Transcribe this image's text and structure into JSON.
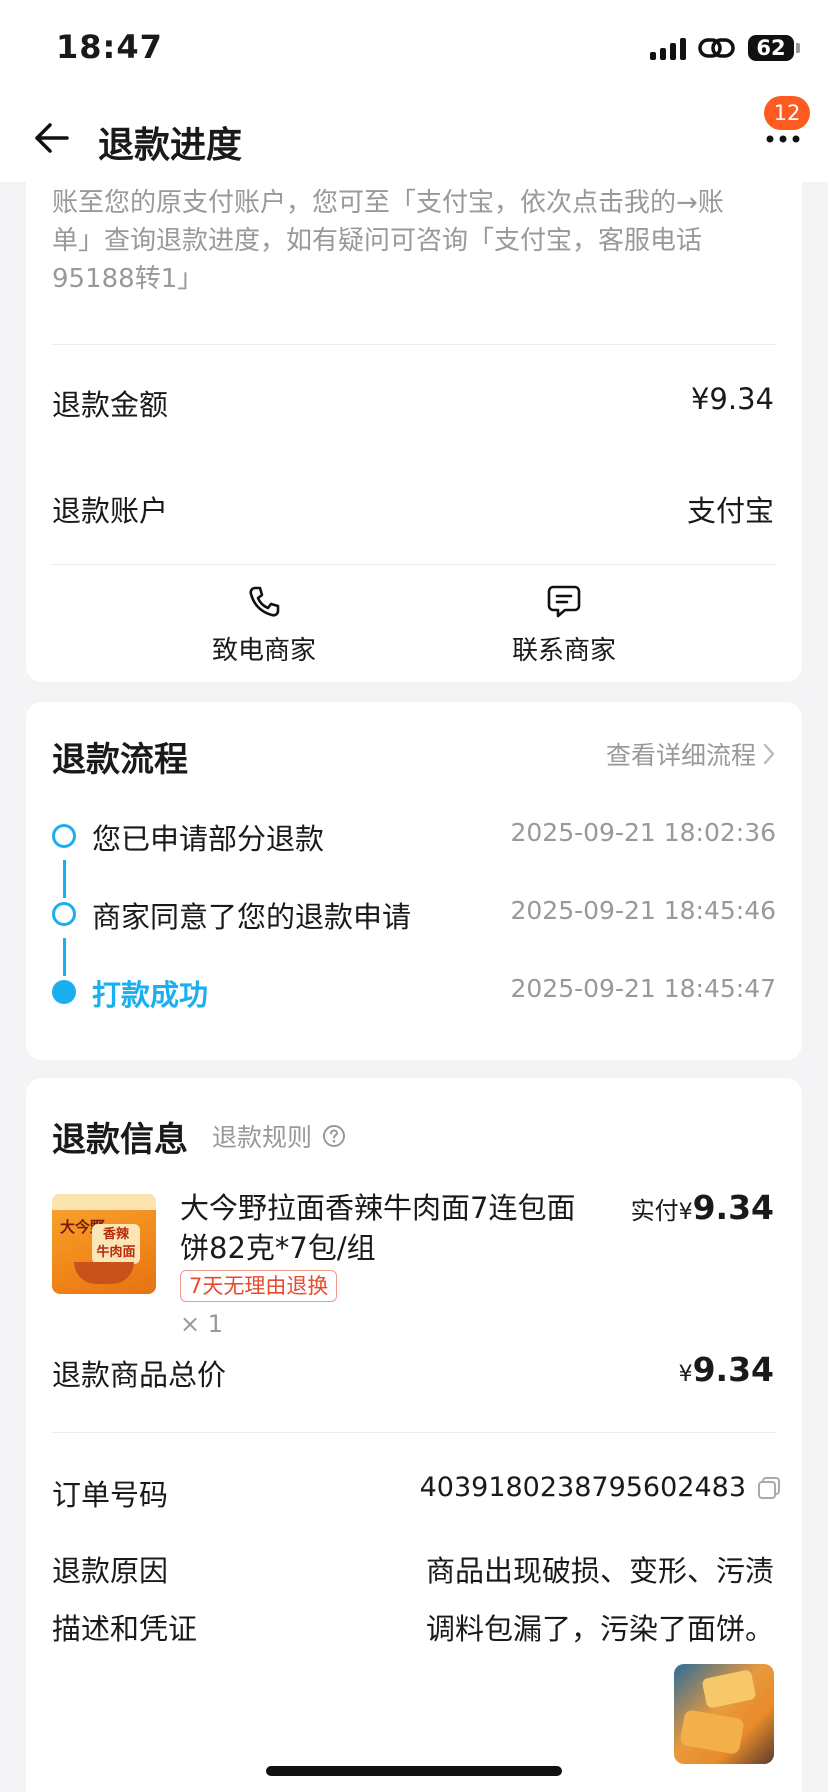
{
  "status_bar": {
    "time": "18:47",
    "battery": "62"
  },
  "header": {
    "title": "退款进度",
    "badge_count": "12"
  },
  "notice": {
    "text": "账至您的原支付账户，您可至「支付宝，依次点击我的→账单」查询退款进度，如有疑问可咨询「支付宝，客服电话95188转1」"
  },
  "refund_summary": {
    "amount_label": "退款金额",
    "amount_value": "¥9.34",
    "account_label": "退款账户",
    "account_value": "支付宝",
    "call_label": "致电商家",
    "contact_label": "联系商家"
  },
  "process": {
    "title": "退款流程",
    "detail_link": "查看详细流程",
    "steps": [
      {
        "label": "您已申请部分退款",
        "time": "2025-09-21 18:02:36"
      },
      {
        "label": "商家同意了您的退款申请",
        "time": "2025-09-21 18:45:46"
      },
      {
        "label": "打款成功",
        "time": "2025-09-21 18:45:47"
      }
    ]
  },
  "refund_info": {
    "title": "退款信息",
    "rules_link": "退款规则",
    "product": {
      "name": "大今野拉面香辣牛肉面7连包面饼82克*7包/组",
      "tag": "7天无理由退换",
      "quantity": "× 1",
      "paid_prefix": "实付",
      "currency": "¥",
      "paid_amount": "9.34"
    },
    "total_label": "退款商品总价",
    "total_currency": "¥",
    "total_amount": "9.34",
    "order_label": "订单号码",
    "order_value": "4039180238795602483",
    "reason_label": "退款原因",
    "reason_value": "商品出现破损、变形、污渍",
    "desc_label": "描述和凭证",
    "desc_value": "调料包漏了，污染了面饼。"
  },
  "colors": {
    "accent": "#1ab0f0",
    "badge": "#ff5a1f",
    "tag": "#e84a30"
  }
}
